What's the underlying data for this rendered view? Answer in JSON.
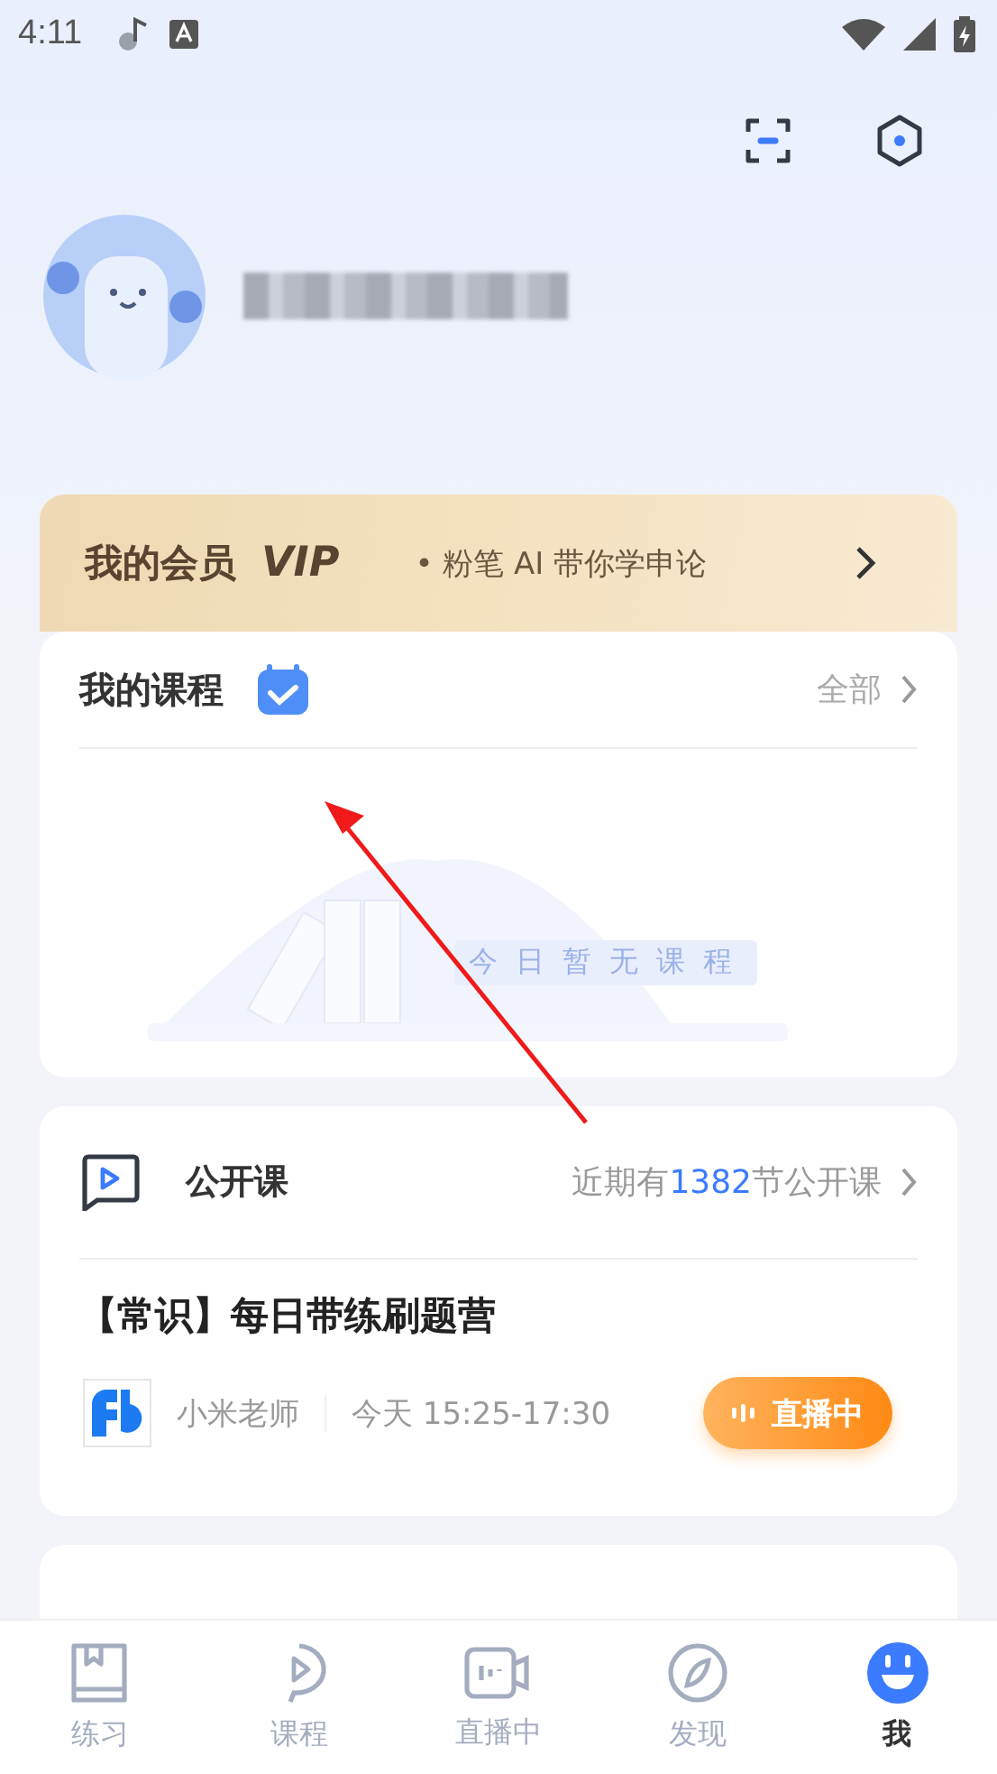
{
  "status_bar": {
    "time": "4:11"
  },
  "vip_banner": {
    "title": "我的会员",
    "badge": "VIP",
    "slogan": "• 粉笔 AI 带你学申论"
  },
  "my_courses": {
    "title": "我的课程",
    "link": "全部",
    "empty_text": "今日暂无课程"
  },
  "open_courses": {
    "title": "公开课",
    "summary_prefix": "近期有",
    "summary_count": "1382",
    "summary_suffix": "节公开课",
    "course": {
      "title": "【常识】每日带练刷题营",
      "teacher": "小米老师",
      "time": "今天 15:25-17:30",
      "live_label": "直播中"
    }
  },
  "tabs": [
    {
      "label": "练习",
      "selected": false
    },
    {
      "label": "课程",
      "selected": false
    },
    {
      "label": "直播中",
      "selected": false
    },
    {
      "label": "发现",
      "selected": false
    },
    {
      "label": "我",
      "selected": true
    }
  ]
}
